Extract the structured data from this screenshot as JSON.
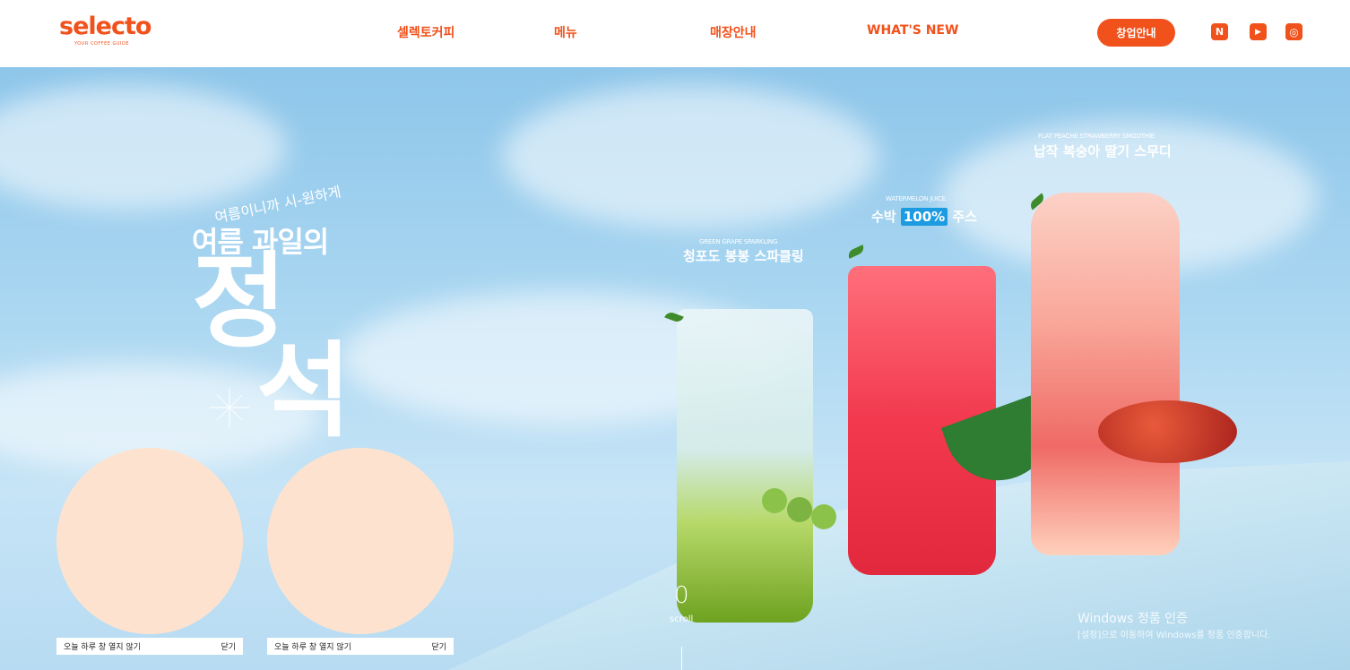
{
  "header": {
    "logo": "selecto",
    "logo_tagline": "YOUR COFFEE GUIDE",
    "nav": [
      "셀렉토커피",
      "메뉴",
      "매장안내",
      "WHAT'S NEW"
    ],
    "cta": "창업안내",
    "social": [
      {
        "name": "naver-blog-icon",
        "glyph": "N"
      },
      {
        "name": "youtube-icon",
        "glyph": "▶"
      },
      {
        "name": "instagram-icon",
        "glyph": "◎"
      }
    ]
  },
  "hero": {
    "kicker": "여름이니까 시-원하게",
    "headline": "여름 과일의",
    "big_char1": "정",
    "big_char2": "석",
    "drinks": [
      {
        "en": "GREEN GRAPE SPARKLING",
        "ko": "청포도 봉봉 스파클링"
      },
      {
        "en": "WATERMELON JUICE",
        "ko_prefix": "수박",
        "ko_badge": "100%",
        "ko_suffix": "주스"
      },
      {
        "en": "FLAT PEACHE STRAWBERRY SMOOTHIE",
        "ko": "납작 복숭아 딸기 스무디"
      }
    ],
    "scroll_num": "0",
    "scroll_label": "scroll"
  },
  "popups": [
    {
      "dont_show": "오늘 하루 창 열지 않기",
      "close": "닫기"
    },
    {
      "dont_show": "오늘 하루 창 열지 않기",
      "close": "닫기"
    }
  ],
  "windows_watermark": {
    "line1": "Windows 정품 인증",
    "line2": "[설정]으로 이동하여 Windows를 정품 인증합니다."
  },
  "colors": {
    "brand": "#f1511b",
    "popup_circle": "#fde3cf",
    "badge": "#1d9be0"
  }
}
